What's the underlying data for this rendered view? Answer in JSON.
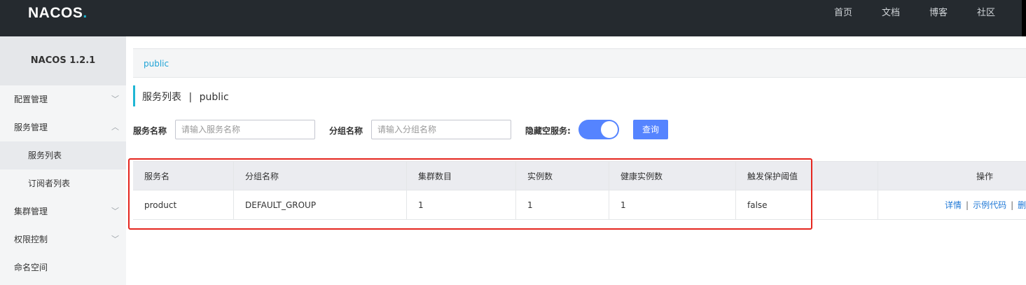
{
  "header": {
    "logo": "NACOS",
    "logo_dot": ".",
    "nav": [
      "首页",
      "文档",
      "博客",
      "社区"
    ]
  },
  "sidebar": {
    "title": "NACOS 1.2.1",
    "items": [
      {
        "label": "配置管理",
        "chevron": "down"
      },
      {
        "label": "服务管理",
        "chevron": "up"
      },
      {
        "label": "服务列表",
        "sub": true,
        "active": true
      },
      {
        "label": "订阅者列表",
        "sub": true
      },
      {
        "label": "集群管理",
        "chevron": "down"
      },
      {
        "label": "权限控制",
        "chevron": "down"
      },
      {
        "label": "命名空间"
      }
    ]
  },
  "breadcrumb": {
    "namespace": "public"
  },
  "page": {
    "title": "服务列表",
    "separator": "|",
    "namespace": "public"
  },
  "filters": {
    "service_label": "服务名称",
    "service_placeholder": "请输入服务名称",
    "group_label": "分组名称",
    "group_placeholder": "请输入分组名称",
    "hide_empty_label": "隐藏空服务:",
    "hide_empty_on": true,
    "query_button": "查询"
  },
  "table": {
    "columns": [
      "服务名",
      "分组名称",
      "集群数目",
      "实例数",
      "健康实例数",
      "触发保护阈值",
      "操作"
    ],
    "rows": [
      {
        "service": "product",
        "group": "DEFAULT_GROUP",
        "clusters": "1",
        "instances": "1",
        "healthy": "1",
        "threshold": "false",
        "actions": [
          "详情",
          "示例代码",
          "删除"
        ]
      }
    ]
  },
  "colors": {
    "accent": "#5584ff",
    "link": "#1f78d6",
    "highlight_box": "#e5261f",
    "topbar": "#252a2f"
  }
}
